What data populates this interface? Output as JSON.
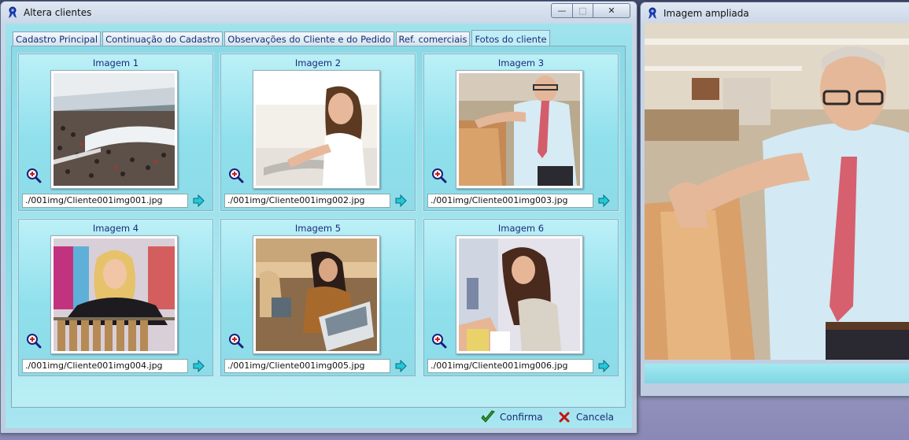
{
  "main_window": {
    "title": "Altera clientes",
    "controls": {
      "minimize": "—",
      "maximize": "□",
      "close": "✕"
    }
  },
  "tabs": [
    {
      "label": "Cadastro Principal"
    },
    {
      "label": "Continuação do Cadastro"
    },
    {
      "label": "Observações do Cliente e do Pedido"
    },
    {
      "label": "Ref. comerciais"
    },
    {
      "label": "Fotos do cliente"
    }
  ],
  "images": [
    {
      "label": "Imagem 1",
      "path": "./001img/Cliente001img001.jpg"
    },
    {
      "label": "Imagem 2",
      "path": "./001img/Cliente001img002.jpg"
    },
    {
      "label": "Imagem 3",
      "path": "./001img/Cliente001img003.jpg"
    },
    {
      "label": "Imagem 4",
      "path": "./001img/Cliente001img004.jpg"
    },
    {
      "label": "Imagem 5",
      "path": "./001img/Cliente001img005.jpg"
    },
    {
      "label": "Imagem 6",
      "path": "./001img/Cliente001img006.jpg"
    }
  ],
  "buttons": {
    "confirm": "Confirma",
    "cancel": "Cancela"
  },
  "preview_window": {
    "title": "Imagem ampliada"
  },
  "colors": {
    "accent_text": "#1a2a7a",
    "panel_cyan": "#8ad9e5"
  }
}
